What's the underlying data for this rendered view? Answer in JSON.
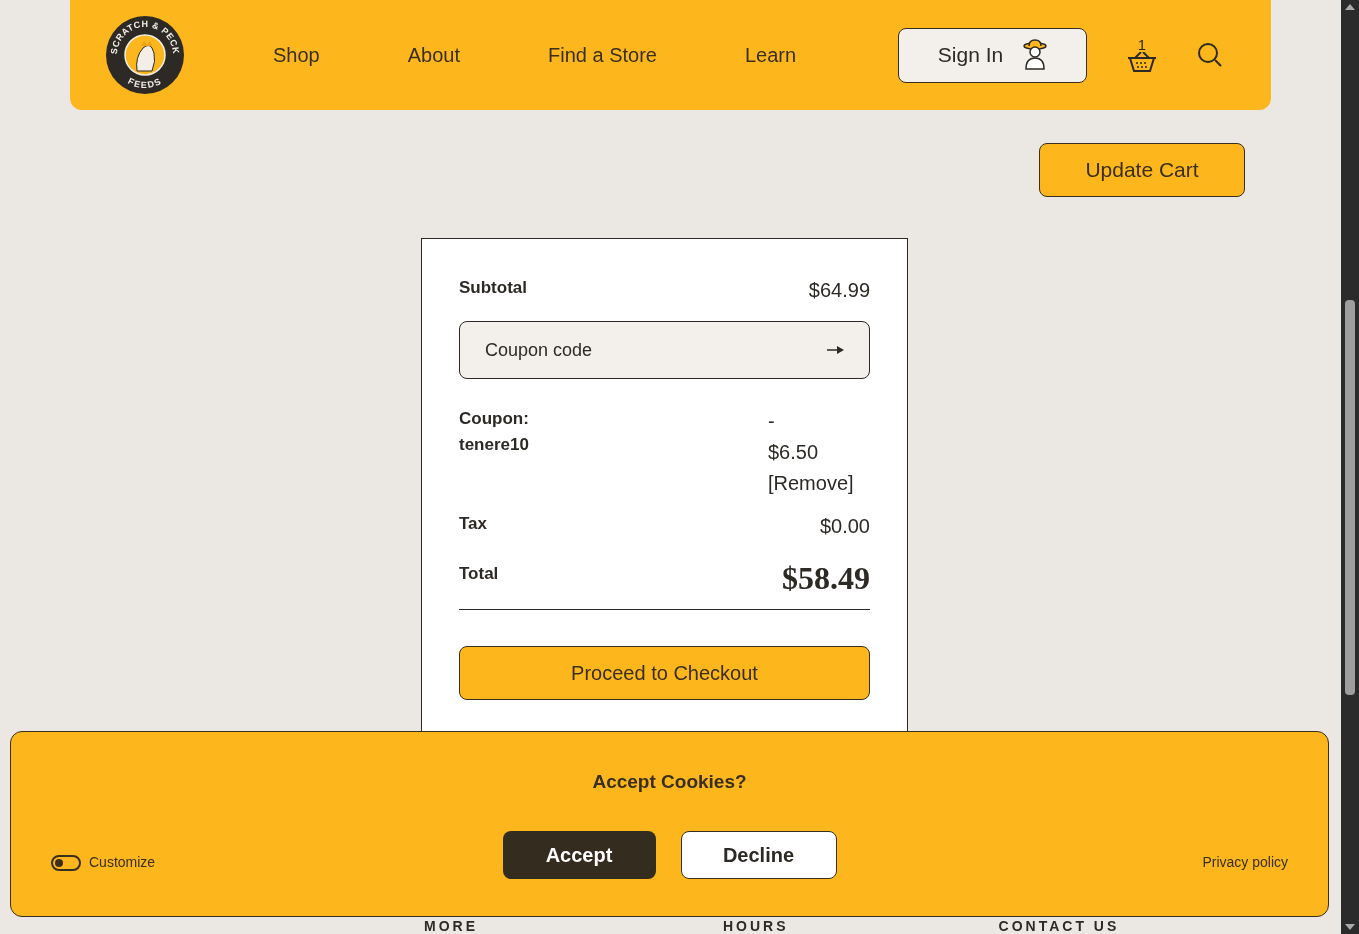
{
  "header": {
    "logo": {
      "top": "SCRATCH & PECK",
      "bottom": "FEEDS"
    },
    "nav": [
      "Shop",
      "About",
      "Find a Store",
      "Learn"
    ],
    "sign_in": "Sign In",
    "cart_count": "1"
  },
  "update_cart": "Update Cart",
  "summary": {
    "subtotal_label": "Subtotal",
    "subtotal": "$64.99",
    "coupon_placeholder": "Coupon code",
    "coupon_label": "Coupon:",
    "coupon_code": "tenere10",
    "discount_sign": "-",
    "discount": "$6.50",
    "remove": "[Remove]",
    "tax_label": "Tax",
    "tax": "$0.00",
    "total_label": "Total",
    "total": "$58.49",
    "checkout": "Proceed to Checkout"
  },
  "cookies": {
    "title": "Accept Cookies?",
    "accept": "Accept",
    "decline": "Decline",
    "customize": {
      "label": "Customize",
      "on": false
    },
    "privacy": "Privacy policy"
  },
  "footer": {
    "headings": [
      "MORE",
      "HOURS",
      "CONTACT US"
    ]
  }
}
